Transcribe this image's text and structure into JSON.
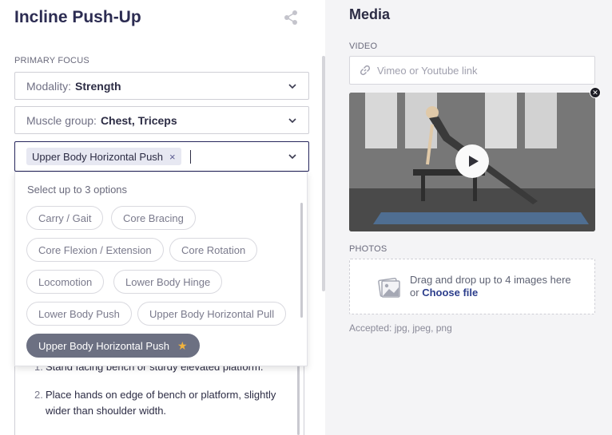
{
  "exercise": {
    "title": "Incline Push-Up"
  },
  "primary_focus": {
    "label": "PRIMARY FOCUS",
    "modality": {
      "key": "Modality:",
      "value": "Strength"
    },
    "muscle_group": {
      "key": "Muscle group:",
      "value": "Chest, Triceps"
    },
    "movement": {
      "selected_tag": "Upper Body Horizontal Push",
      "remove_glyph": "×"
    }
  },
  "dropdown": {
    "hint": "Select up to 3 options",
    "options": [
      "Carry / Gait",
      "Core Bracing",
      "Core Flexion / Extension",
      "Core Rotation",
      "Locomotion",
      "Lower Body Hinge",
      "Lower Body Push",
      "Upper Body Horizontal Pull",
      "Upper Body Horizontal Push"
    ],
    "selected_option": "Upper Body Horizontal Push",
    "star_glyph": "★",
    "star_color": "#f2b33c"
  },
  "instructions": {
    "steps": [
      {
        "num": "1.",
        "text": "Stand facing bench or sturdy elevated platform."
      },
      {
        "num": "2.",
        "text": "Place hands on edge of bench or platform, slightly wider than shoulder width."
      }
    ]
  },
  "media": {
    "title": "Media",
    "video_label": "VIDEO",
    "video_placeholder": "Vimeo or Youtube link",
    "video_close_glyph": "✕",
    "photos_label": "PHOTOS",
    "photos_drop_text": "Drag and drop up to 4 images here",
    "photos_or": "or",
    "photos_choose": "Choose file",
    "accepted": "Accepted: jpg, jpeg, png"
  },
  "colors": {
    "accent": "#26265c",
    "selected_chip": "#6c7082",
    "panel": "#f4f4f6"
  }
}
